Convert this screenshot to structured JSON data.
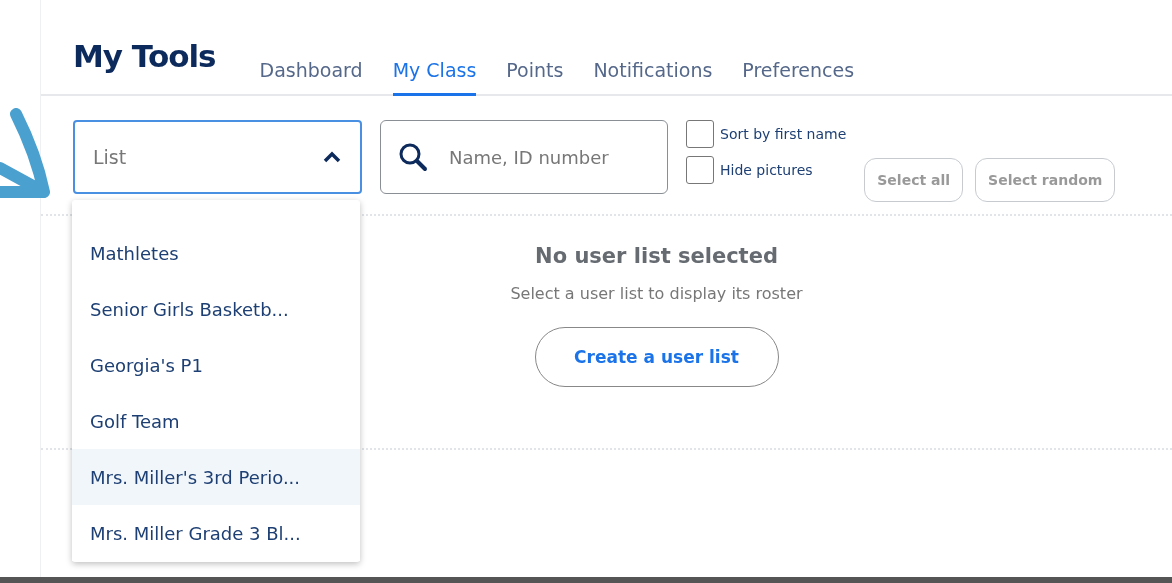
{
  "header": {
    "title": "My Tools"
  },
  "tabs": [
    {
      "label": "Dashboard",
      "selected": false
    },
    {
      "label": "My Class",
      "selected": true
    },
    {
      "label": "Points",
      "selected": false
    },
    {
      "label": "Notifications",
      "selected": false
    },
    {
      "label": "Preferences",
      "selected": false
    }
  ],
  "list_select": {
    "placeholder": "List",
    "expanded": true
  },
  "search": {
    "placeholder": "Name, ID number"
  },
  "options": [
    {
      "label": "Sort by first name",
      "checked": false
    },
    {
      "label": "Hide pictures",
      "checked": false
    }
  ],
  "buttons": [
    "Select all",
    "Select random"
  ],
  "empty_state": {
    "title": "No user list selected",
    "message": "Select a user list to display its roster",
    "action": "Create a user list"
  },
  "dropdown": {
    "items": [
      {
        "label": "Mathletes",
        "highlighted": false
      },
      {
        "label": "Senior Girls Basketb...",
        "highlighted": false
      },
      {
        "label": "Georgia's P1",
        "highlighted": false
      },
      {
        "label": "Golf Team",
        "highlighted": false
      },
      {
        "label": "Mrs. Miller's 3rd Perio...",
        "highlighted": true
      },
      {
        "label": "Mrs. Miller Grade 3 Bl...",
        "highlighted": false
      }
    ]
  }
}
